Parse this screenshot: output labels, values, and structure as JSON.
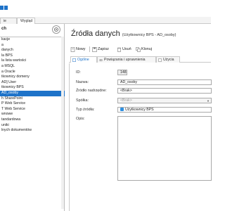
{
  "tabs": [
    "ie",
    "Wygląd"
  ],
  "left_panel": {
    "title": "ch",
    "items": [
      "kacje",
      "a",
      "danych",
      "la BPS",
      "la lista wartości",
      "a MSQL",
      "a Oracle",
      "tkownicy domeny",
      "AD] User",
      "tkownicy BPS",
      "AD_osoby",
      "h SharePoint",
      "P Web Service",
      "T Web Service",
      "wnowe",
      "tandardowa",
      "uniki",
      "lnych dokumentów"
    ],
    "selected_index": 10
  },
  "main": {
    "title": "Źródła danych",
    "subtitle": "(Użytkownicy BPS - AD_osoby)",
    "toolbar": {
      "new": "Nowy",
      "save": "Zapisz",
      "delete": "Usuń",
      "copy": "Klonuj"
    },
    "subtabs": [
      "Ogólne",
      "Powiązania i uprawnienia",
      "Użycia"
    ],
    "form": {
      "id_label": "ID:",
      "id_value": "148",
      "name_label": "Nazwa:",
      "name_value": "AD_osoby",
      "parent_label": "Źródło nadrzędne:",
      "parent_value": "<Brak>",
      "company_label": "Spółka:",
      "company_value": "<Brak>",
      "type_label": "Typ źródła:",
      "type_value": "Użytkownicy BPS",
      "desc_label": "Opis:",
      "desc_value": ""
    }
  },
  "colors": {
    "selection": "#1e73c9",
    "accent": "#2f8fe0"
  }
}
